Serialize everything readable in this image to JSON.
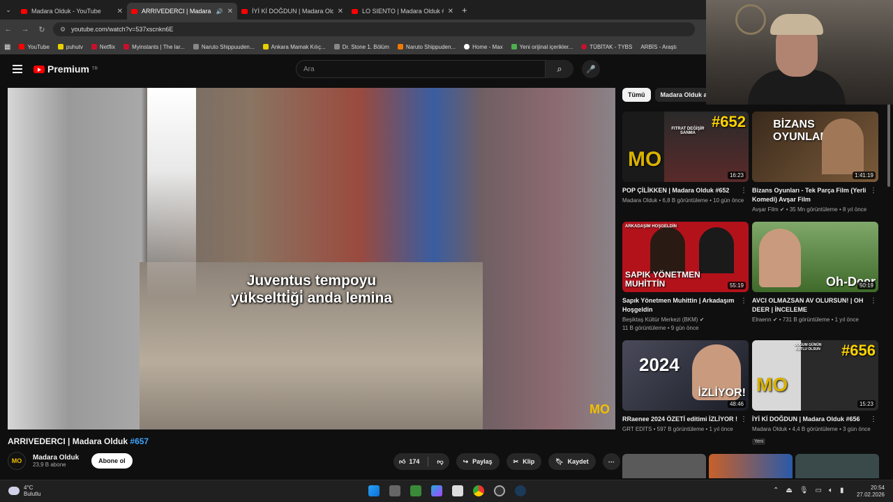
{
  "browser": {
    "tabs": [
      {
        "title": "Madara Olduk - YouTube",
        "active": false
      },
      {
        "title": "ARRIVEDERCI | Madara Olduk #657",
        "active": true
      },
      {
        "title": "İYİ Kİ DOĞDUN | Madara Olduk #656",
        "active": false
      },
      {
        "title": "LO SIENTO | Madara Olduk #655",
        "active": false
      }
    ],
    "url": "youtube.com/watch?v=537xscnkn6E",
    "bookmarks": [
      "YouTube",
      "puhutv",
      "Netflix",
      "Myinstants | The lar...",
      "Naruto Shippuuden...",
      "Ankara Mamak Kılıç...",
      "Dr. Stone 1. Bölüm",
      "Naruto Shippuden...",
      "Home - Max",
      "Yeni orijinal içerikler...",
      "TÜBİTAK - TYBS",
      "ARBİS - Araştı"
    ]
  },
  "youtube": {
    "logo": "Premium",
    "logo_sup": "TR",
    "search_placeholder": "Ara",
    "video": {
      "subtitle_line1": "Juventus tempoyu",
      "subtitle_line2": "yükseltti̇ği̇ anda lemina",
      "title": "ARRIVEDERCI | Madara Olduk",
      "title_tag": "#657",
      "channel": "Madara Olduk",
      "subs": "23,9 B abone",
      "subscribe": "Abone ol",
      "likes": "174",
      "share": "Paylaş",
      "clip": "Klip",
      "save": "Kaydet",
      "watermark": "MO"
    },
    "chips": [
      "Tümü",
      "Madara Olduk a"
    ],
    "recs": [
      {
        "title": "POP ÇİLİKKEN | Madara Olduk #652",
        "channel": "Madara Olduk",
        "meta": "6,8 B görüntüleme • 10 gün önce",
        "dur": "16:23",
        "overlay": "#652",
        "thumbtext": "FITRAT DEĞİŞİR SANMA",
        "color": "#d9b200"
      },
      {
        "title": "Bizans Oyunları - Tek Parça Film (Yerli Komedi) Avşar Film",
        "channel": "Avşar Film",
        "meta": "35 Mn görüntüleme • 8 yıl önce",
        "dur": "1:41:19",
        "overlay": "BİZANS OYUNLARI",
        "color": "#6b4a2c"
      },
      {
        "title": "Sapık Yönetmen Muhittin | Arkadaşım Hoşgeldin",
        "channel": "Beşiktaş Kültür Merkezi (BKM)",
        "meta": "11 B görüntüleme • 9 gün önce",
        "dur": "55:19",
        "overlay": "SAPIK YÖNETMEN MUHİTTİN",
        "thumbtext": "ARKADAŞIM HOŞGELDİN",
        "color": "#b3121b"
      },
      {
        "title": "AVCI OLMAZSAN AV OLURSUN! | OH DEER | İNCELEME",
        "channel": "Elraenn",
        "meta": "731 B görüntüleme • 1 yıl önce",
        "dur": "50:19",
        "overlay": "Oh-Deer",
        "color": "#4f7a3a"
      },
      {
        "title": "RRaenee 2024 ÖZETİ editimi İZLİYOR !",
        "channel": "GRT EDİTS",
        "meta": "597 B görüntüleme • 1 yıl önce",
        "dur": "48:46",
        "overlay": "2024",
        "overlay2": "İZLİYOR!",
        "color": "#2e3340"
      },
      {
        "title": "İYİ Kİ DOĞDUN | Madara Olduk #656",
        "channel": "Madara Olduk",
        "meta": "4,4 B görüntüleme • 3 gün önce",
        "dur": "15:23",
        "overlay": "#656",
        "thumbtext": "DOĞUM GÜNÜN KUTLU OLSUN",
        "badge": "Yeni",
        "color": "#d9b200"
      }
    ]
  },
  "taskbar": {
    "temp": "4°C",
    "weather": "Bulutlu",
    "time": "20:54",
    "date": "27.02.2026"
  }
}
